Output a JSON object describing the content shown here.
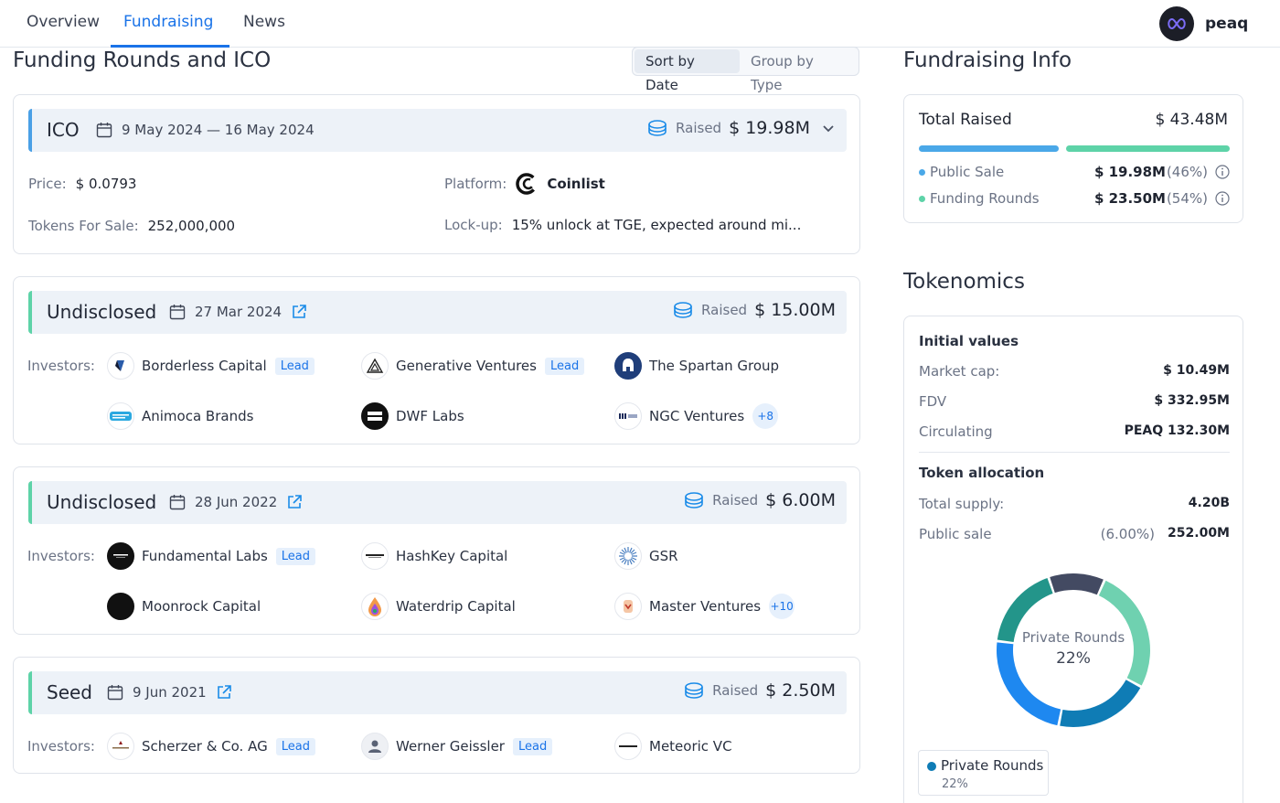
{
  "nav": {
    "tabs": [
      "Overview",
      "Fundraising",
      "News"
    ],
    "active": "Fundraising",
    "project": "peaq"
  },
  "main": {
    "title": "Funding Rounds and ICO",
    "sort_by_date": "Sort by Date",
    "group_by_type": "Group by Type"
  },
  "ico": {
    "type": "ICO",
    "dates": "9 May 2024 — 16 May 2024",
    "raised_label": "Raised",
    "raised": "$ 19.98M",
    "price_label": "Price:",
    "price": "$ 0.0793",
    "platform_label": "Platform:",
    "platform": "Coinlist",
    "tokens_label": "Tokens For Sale:",
    "tokens": "252,000,000",
    "lockup_label": "Lock-up:",
    "lockup": "15% unlock at TGE, expected around mi..."
  },
  "rounds": [
    {
      "type": "Undisclosed",
      "date": "27 Mar 2024",
      "raised_label": "Raised",
      "raised": "$ 15.00M",
      "investors_label": "Investors:",
      "investors": [
        {
          "name": "Borderless Capital",
          "lead": "Lead"
        },
        {
          "name": "Generative Ventures",
          "lead": "Lead"
        },
        {
          "name": "The Spartan Group"
        },
        {
          "name": "Animoca Brands"
        },
        {
          "name": "DWF Labs"
        },
        {
          "name": "NGC Ventures",
          "more": "+8"
        }
      ]
    },
    {
      "type": "Undisclosed",
      "date": "28 Jun 2022",
      "raised_label": "Raised",
      "raised": "$ 6.00M",
      "investors_label": "Investors:",
      "investors": [
        {
          "name": "Fundamental Labs",
          "lead": "Lead"
        },
        {
          "name": "HashKey Capital"
        },
        {
          "name": "GSR"
        },
        {
          "name": "Moonrock Capital"
        },
        {
          "name": "Waterdrip Capital"
        },
        {
          "name": "Master Ventures",
          "more": "+10"
        }
      ]
    },
    {
      "type": "Seed",
      "date": "9 Jun 2021",
      "raised_label": "Raised",
      "raised": "$ 2.50M",
      "investors_label": "Investors:",
      "investors": [
        {
          "name": "Scherzer & Co. AG",
          "lead": "Lead"
        },
        {
          "name": "Werner Geissler",
          "lead": "Lead"
        },
        {
          "name": "Meteoric VC"
        }
      ]
    }
  ],
  "fundraising_info": {
    "title": "Fundraising Info",
    "total_label": "Total Raised",
    "total": "$ 43.48M",
    "public_sale_label": "Public Sale",
    "public_sale": "$ 19.98M",
    "public_sale_pct": "(46%)",
    "public_sale_share": 0.46,
    "funding_rounds_label": "Funding Rounds",
    "funding_rounds": "$ 23.50M",
    "funding_rounds_pct": "(54%)",
    "funding_rounds_share": 0.54,
    "colors": {
      "public_sale": "#4aa8e8",
      "funding_rounds": "#5ed3a8"
    }
  },
  "tokenomics": {
    "title": "Tokenomics",
    "initial_values_label": "Initial values",
    "market_cap_label": "Market cap:",
    "market_cap": "$ 10.49M",
    "fdv_label": "FDV",
    "fdv": "$ 332.95M",
    "circulating_label": "Circulating",
    "circulating": "PEAQ 132.30M",
    "token_allocation_label": "Token allocation",
    "total_supply_label": "Total supply:",
    "total_supply": "4.20B",
    "public_sale_label": "Public sale",
    "public_sale_pct": "(6.00%)",
    "public_sale": "252.00M",
    "donut_center_label": "Private Rounds",
    "donut_center_value": "22%",
    "legend_label": "Private Rounds",
    "legend_value": "22%"
  },
  "chart_data": {
    "type": "pie",
    "style": "donut",
    "highlighted": "Private Rounds",
    "slices": [
      {
        "label": "Private Rounds",
        "value": 22,
        "color": "#6fd1b0"
      },
      {
        "value": 17,
        "color": "#0f7cb5"
      },
      {
        "value": 20,
        "color": "#1e88f0"
      },
      {
        "value": 15,
        "color": "#23958a"
      },
      {
        "value": 10,
        "color": "#434a62"
      }
    ]
  }
}
